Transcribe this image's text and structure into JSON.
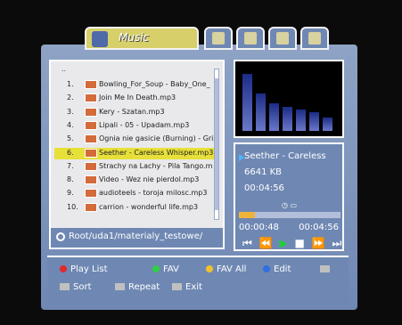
{
  "tabs": {
    "main_label": "Music",
    "icons": [
      "music-icon",
      "tools-icon",
      "settings-icon",
      "film-icon",
      "photo-icon"
    ]
  },
  "list": {
    "up_label": "..",
    "items": [
      {
        "n": "1.",
        "t": "Bowling_For_Soup - Baby_One_"
      },
      {
        "n": "2.",
        "t": "Join Me In Death.mp3"
      },
      {
        "n": "3.",
        "t": "Kery - Szatan.mp3"
      },
      {
        "n": "4.",
        "t": "Lipali - 05 - Upadam.mp3"
      },
      {
        "n": "5.",
        "t": "Ognia nie gasicie (Burning) - Gris"
      },
      {
        "n": "6.",
        "t": "Seether - Careless Whisper.mp3"
      },
      {
        "n": "7.",
        "t": "Strachy na Lachy - Pila Tango.m"
      },
      {
        "n": "8.",
        "t": "Video - Wez nie pierdol.mp3"
      },
      {
        "n": "9.",
        "t": "audioteels - toroja milosc.mp3"
      },
      {
        "n": "10.",
        "t": "carrion - wonderful life.mp3"
      }
    ],
    "selected_index": 5,
    "path": "Root/uda1/materialy_testowe/"
  },
  "now_playing": {
    "title": "Seether - Careless",
    "size": "6641 KB",
    "duration": "00:04:56",
    "elapsed": "00:00:48",
    "total": "00:04:56",
    "progress_fraction": 0.16
  },
  "eq_levels": [
    0.92,
    0.6,
    0.44,
    0.38,
    0.34,
    0.3,
    0.22
  ],
  "legend": {
    "play_list": "Play List",
    "fav": "FAV",
    "fav_all": "FAV All",
    "edit": "Edit",
    "sort": "Sort",
    "repeat": "Repeat",
    "exit": "Exit"
  },
  "colors": {
    "red": "#e12a2a",
    "green": "#2fcf45",
    "yellow": "#f2c12b",
    "blue": "#2f6fe0",
    "accent": "#6f88b3"
  }
}
